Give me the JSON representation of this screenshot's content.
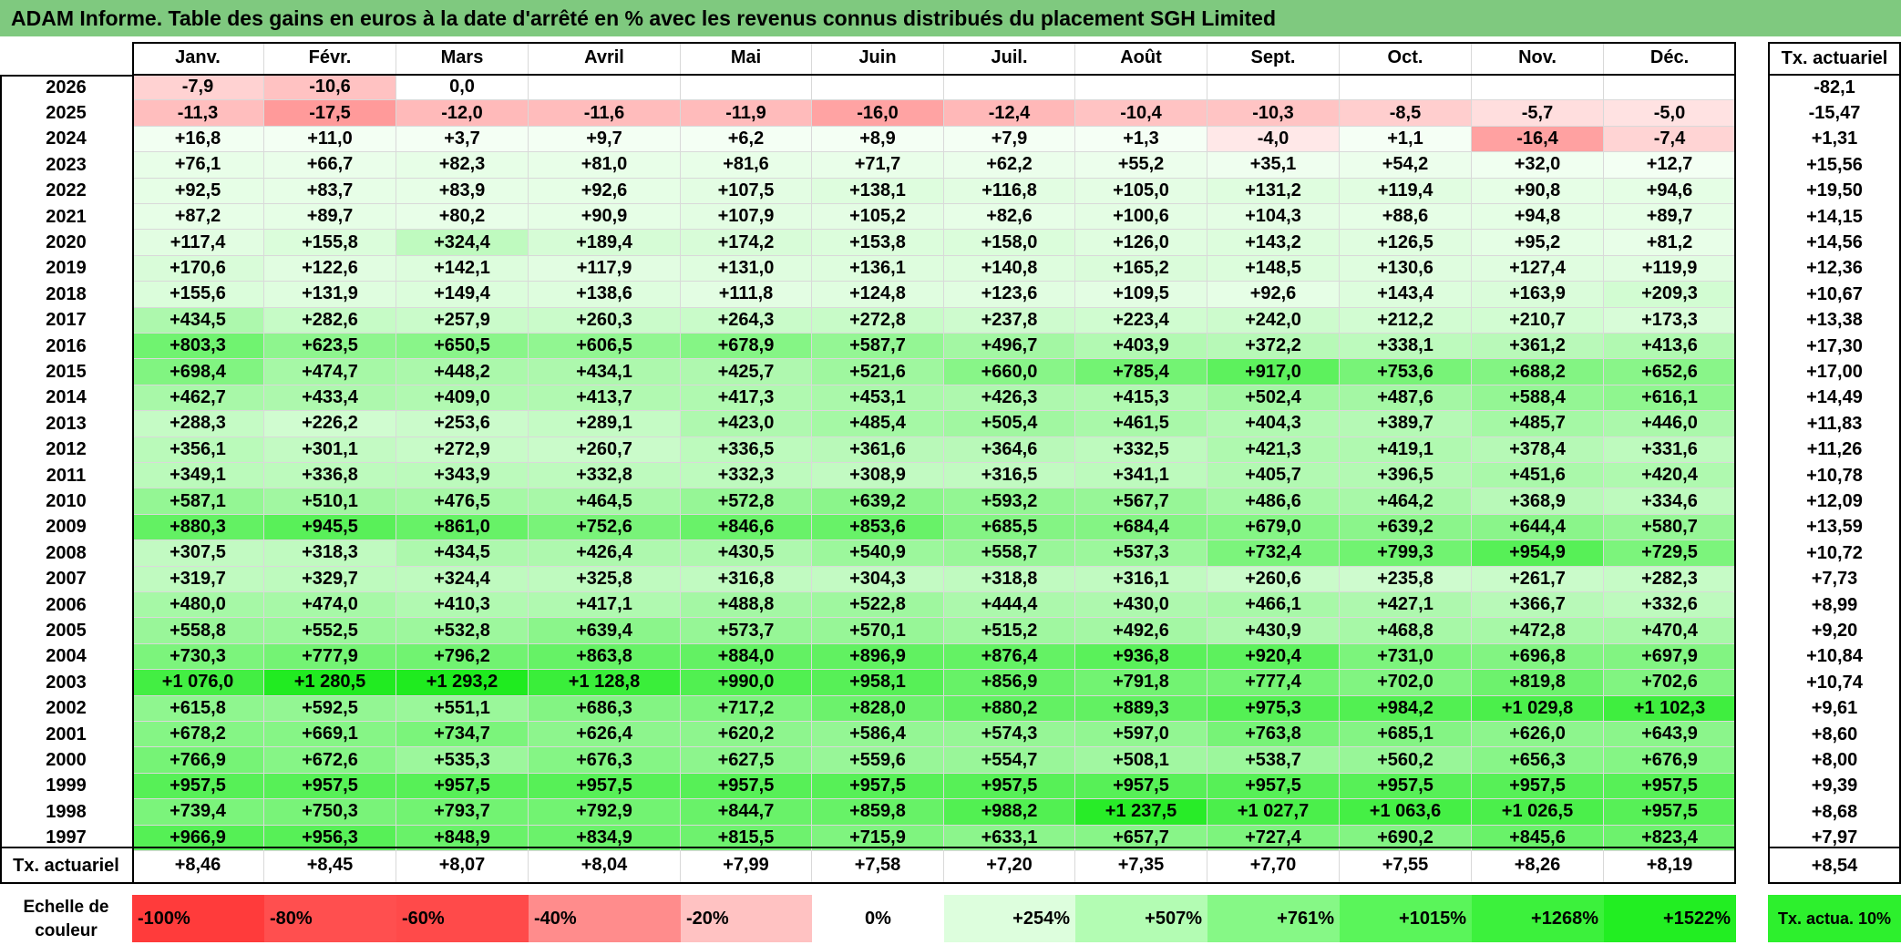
{
  "title": "ADAM Informe. Table des gains en euros à la date d'arrêté en % avec les revenus connus distribués du placement SGH Limited",
  "chart_data": {
    "type": "table",
    "columns": [
      "Janv.",
      "Févr.",
      "Mars",
      "Avril",
      "Mai",
      "Juin",
      "Juil.",
      "Août",
      "Sept.",
      "Oct.",
      "Nov.",
      "Déc."
    ],
    "last_column_header": "Tx. actuariel",
    "rows": [
      {
        "year": "2026",
        "values": [
          "-7,9",
          "-10,6",
          "0,0",
          "",
          "",
          "",
          "",
          "",
          "",
          "",
          "",
          ""
        ],
        "rate": "-82,1"
      },
      {
        "year": "2025",
        "values": [
          "-11,3",
          "-17,5",
          "-12,0",
          "-11,6",
          "-11,9",
          "-16,0",
          "-12,4",
          "-10,4",
          "-10,3",
          "-8,5",
          "-5,7",
          "-5,0"
        ],
        "rate": "-15,47"
      },
      {
        "year": "2024",
        "values": [
          "+16,8",
          "+11,0",
          "+3,7",
          "+9,7",
          "+6,2",
          "+8,9",
          "+7,9",
          "+1,3",
          "-4,0",
          "+1,1",
          "-16,4",
          "-7,4"
        ],
        "rate": "+1,31"
      },
      {
        "year": "2023",
        "values": [
          "+76,1",
          "+66,7",
          "+82,3",
          "+81,0",
          "+81,6",
          "+71,7",
          "+62,2",
          "+55,2",
          "+35,1",
          "+54,2",
          "+32,0",
          "+12,7"
        ],
        "rate": "+15,56"
      },
      {
        "year": "2022",
        "values": [
          "+92,5",
          "+83,7",
          "+83,9",
          "+92,6",
          "+107,5",
          "+138,1",
          "+116,8",
          "+105,0",
          "+131,2",
          "+119,4",
          "+90,8",
          "+94,6"
        ],
        "rate": "+19,50"
      },
      {
        "year": "2021",
        "values": [
          "+87,2",
          "+89,7",
          "+80,2",
          "+90,9",
          "+107,9",
          "+105,2",
          "+82,6",
          "+100,6",
          "+104,3",
          "+88,6",
          "+94,8",
          "+89,7"
        ],
        "rate": "+14,15"
      },
      {
        "year": "2020",
        "values": [
          "+117,4",
          "+155,8",
          "+324,4",
          "+189,4",
          "+174,2",
          "+153,8",
          "+158,0",
          "+126,0",
          "+143,2",
          "+126,5",
          "+95,2",
          "+81,2"
        ],
        "rate": "+14,56"
      },
      {
        "year": "2019",
        "values": [
          "+170,6",
          "+122,6",
          "+142,1",
          "+117,9",
          "+131,0",
          "+136,1",
          "+140,8",
          "+165,2",
          "+148,5",
          "+130,6",
          "+127,4",
          "+119,9"
        ],
        "rate": "+12,36"
      },
      {
        "year": "2018",
        "values": [
          "+155,6",
          "+131,9",
          "+149,4",
          "+138,6",
          "+111,8",
          "+124,8",
          "+123,6",
          "+109,5",
          "+92,6",
          "+143,4",
          "+163,9",
          "+209,3"
        ],
        "rate": "+10,67"
      },
      {
        "year": "2017",
        "values": [
          "+434,5",
          "+282,6",
          "+257,9",
          "+260,3",
          "+264,3",
          "+272,8",
          "+237,8",
          "+223,4",
          "+242,0",
          "+212,2",
          "+210,7",
          "+173,3"
        ],
        "rate": "+13,38"
      },
      {
        "year": "2016",
        "values": [
          "+803,3",
          "+623,5",
          "+650,5",
          "+606,5",
          "+678,9",
          "+587,7",
          "+496,7",
          "+403,9",
          "+372,2",
          "+338,1",
          "+361,2",
          "+413,6"
        ],
        "rate": "+17,30"
      },
      {
        "year": "2015",
        "values": [
          "+698,4",
          "+474,7",
          "+448,2",
          "+434,1",
          "+425,7",
          "+521,6",
          "+660,0",
          "+785,4",
          "+917,0",
          "+753,6",
          "+688,2",
          "+652,6"
        ],
        "rate": "+17,00"
      },
      {
        "year": "2014",
        "values": [
          "+462,7",
          "+433,4",
          "+409,0",
          "+413,7",
          "+417,3",
          "+453,1",
          "+426,3",
          "+415,3",
          "+502,4",
          "+487,6",
          "+588,4",
          "+616,1"
        ],
        "rate": "+14,49"
      },
      {
        "year": "2013",
        "values": [
          "+288,3",
          "+226,2",
          "+253,6",
          "+289,1",
          "+423,0",
          "+485,4",
          "+505,4",
          "+461,5",
          "+404,3",
          "+389,7",
          "+485,7",
          "+446,0"
        ],
        "rate": "+11,83"
      },
      {
        "year": "2012",
        "values": [
          "+356,1",
          "+301,1",
          "+272,9",
          "+260,7",
          "+336,5",
          "+361,6",
          "+364,6",
          "+332,5",
          "+421,3",
          "+419,1",
          "+378,4",
          "+331,6"
        ],
        "rate": "+11,26"
      },
      {
        "year": "2011",
        "values": [
          "+349,1",
          "+336,8",
          "+343,9",
          "+332,8",
          "+332,3",
          "+308,9",
          "+316,5",
          "+341,1",
          "+405,7",
          "+396,5",
          "+451,6",
          "+420,4"
        ],
        "rate": "+10,78"
      },
      {
        "year": "2010",
        "values": [
          "+587,1",
          "+510,1",
          "+476,5",
          "+464,5",
          "+572,8",
          "+639,2",
          "+593,2",
          "+567,7",
          "+486,6",
          "+464,2",
          "+368,9",
          "+334,6"
        ],
        "rate": "+12,09"
      },
      {
        "year": "2009",
        "values": [
          "+880,3",
          "+945,5",
          "+861,0",
          "+752,6",
          "+846,6",
          "+853,6",
          "+685,5",
          "+684,4",
          "+679,0",
          "+639,2",
          "+644,4",
          "+580,7"
        ],
        "rate": "+13,59"
      },
      {
        "year": "2008",
        "values": [
          "+307,5",
          "+318,3",
          "+434,5",
          "+426,4",
          "+430,5",
          "+540,9",
          "+558,7",
          "+537,3",
          "+732,4",
          "+799,3",
          "+954,9",
          "+729,5"
        ],
        "rate": "+10,72"
      },
      {
        "year": "2007",
        "values": [
          "+319,7",
          "+329,7",
          "+324,4",
          "+325,8",
          "+316,8",
          "+304,3",
          "+318,8",
          "+316,1",
          "+260,6",
          "+235,8",
          "+261,7",
          "+282,3"
        ],
        "rate": "+7,73"
      },
      {
        "year": "2006",
        "values": [
          "+480,0",
          "+474,0",
          "+410,3",
          "+417,1",
          "+488,8",
          "+522,8",
          "+444,4",
          "+430,0",
          "+466,1",
          "+427,1",
          "+366,7",
          "+332,6"
        ],
        "rate": "+8,99"
      },
      {
        "year": "2005",
        "values": [
          "+558,8",
          "+552,5",
          "+532,8",
          "+639,4",
          "+573,7",
          "+570,1",
          "+515,2",
          "+492,6",
          "+430,9",
          "+468,8",
          "+472,8",
          "+470,4"
        ],
        "rate": "+9,20"
      },
      {
        "year": "2004",
        "values": [
          "+730,3",
          "+777,9",
          "+796,2",
          "+863,8",
          "+884,0",
          "+896,9",
          "+876,4",
          "+936,8",
          "+920,4",
          "+731,0",
          "+696,8",
          "+697,9"
        ],
        "rate": "+10,84"
      },
      {
        "year": "2003",
        "values": [
          "+1 076,0",
          "+1 280,5",
          "+1 293,2",
          "+1 128,8",
          "+990,0",
          "+958,1",
          "+856,9",
          "+791,8",
          "+777,4",
          "+702,0",
          "+819,8",
          "+702,6"
        ],
        "rate": "+10,74"
      },
      {
        "year": "2002",
        "values": [
          "+615,8",
          "+592,5",
          "+551,1",
          "+686,3",
          "+717,2",
          "+828,0",
          "+880,2",
          "+889,3",
          "+975,3",
          "+984,2",
          "+1 029,8",
          "+1 102,3"
        ],
        "rate": "+9,61"
      },
      {
        "year": "2001",
        "values": [
          "+678,2",
          "+669,1",
          "+734,7",
          "+626,4",
          "+620,2",
          "+586,4",
          "+574,3",
          "+597,0",
          "+763,8",
          "+685,1",
          "+626,0",
          "+643,9"
        ],
        "rate": "+8,60"
      },
      {
        "year": "2000",
        "values": [
          "+766,9",
          "+672,6",
          "+535,3",
          "+676,3",
          "+627,5",
          "+559,6",
          "+554,7",
          "+508,1",
          "+538,7",
          "+560,2",
          "+656,3",
          "+676,9"
        ],
        "rate": "+8,00"
      },
      {
        "year": "1999",
        "values": [
          "+957,5",
          "+957,5",
          "+957,5",
          "+957,5",
          "+957,5",
          "+957,5",
          "+957,5",
          "+957,5",
          "+957,5",
          "+957,5",
          "+957,5",
          "+957,5"
        ],
        "rate": "+9,39"
      },
      {
        "year": "1998",
        "values": [
          "+739,4",
          "+750,3",
          "+793,7",
          "+792,9",
          "+844,7",
          "+859,8",
          "+988,2",
          "+1 237,5",
          "+1 027,7",
          "+1 063,6",
          "+1 026,5",
          "+957,5"
        ],
        "rate": "+8,68"
      },
      {
        "year": "1997",
        "values": [
          "+966,9",
          "+956,3",
          "+848,9",
          "+834,9",
          "+815,5",
          "+715,9",
          "+633,1",
          "+657,7",
          "+727,4",
          "+690,2",
          "+845,6",
          "+823,4"
        ],
        "rate": "+7,97"
      }
    ],
    "summary_row": {
      "label": "Tx. actuariel",
      "values": [
        "+8,46",
        "+8,45",
        "+8,07",
        "+8,04",
        "+7,99",
        "+7,58",
        "+7,20",
        "+7,35",
        "+7,70",
        "+7,55",
        "+8,26",
        "+8,19"
      ],
      "overall": "+8,54"
    },
    "color_scale": {
      "label": "Echelle de couleur",
      "stops": [
        "-100%",
        "-80%",
        "-60%",
        "-40%",
        "-20%",
        "0%",
        "+254%",
        "+507%",
        "+761%",
        "+1015%",
        "+1268%",
        "+1522%"
      ],
      "stop_colors": [
        "#ff3b3b",
        "#ff4f4f",
        "#ff4a4a",
        "#ff8c8c",
        "#ffc2c2",
        "#ffffff",
        "#ddfedd",
        "#b3fcb3",
        "#86f886",
        "#5af55a",
        "#3cf13c",
        "#22ee22"
      ],
      "rate_label": "Tx. actua. 10%",
      "rate_color": "#2df02d"
    }
  }
}
